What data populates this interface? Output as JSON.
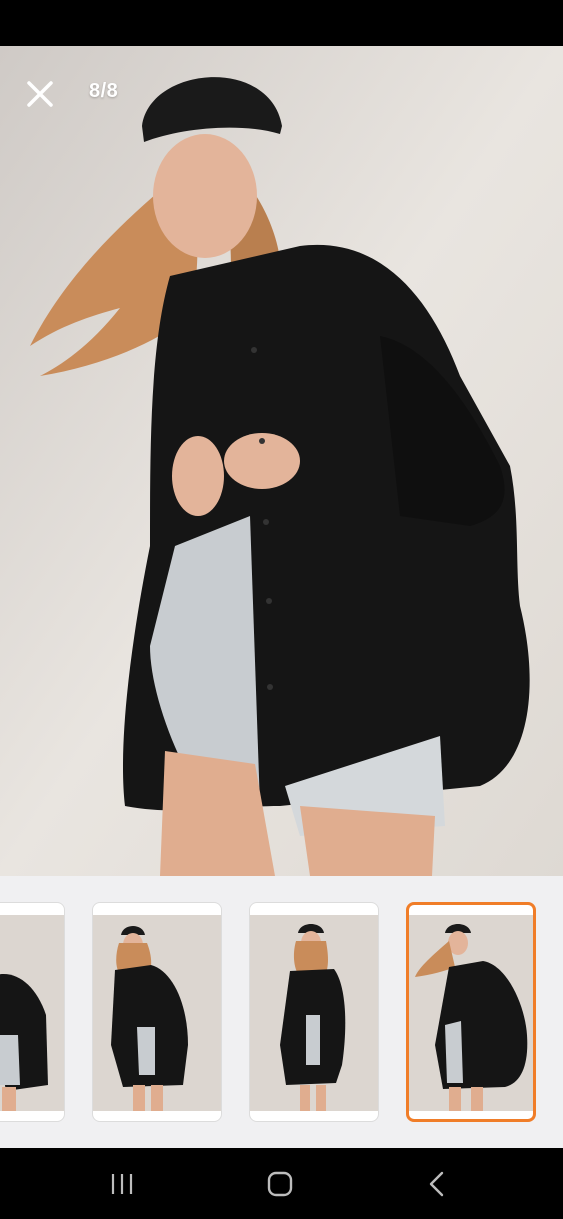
{
  "viewer": {
    "counter": "8/8",
    "close_icon": "close-icon"
  },
  "thumbnails": [
    {
      "index": 5,
      "selected": false
    },
    {
      "index": 6,
      "selected": false
    },
    {
      "index": 7,
      "selected": false
    },
    {
      "index": 8,
      "selected": true
    }
  ],
  "colors": {
    "accent": "#f07d28",
    "photo_background": "#e6e2dd",
    "shirt": "#151515",
    "hair": "#c98c5a",
    "denim": "#c8ccd0",
    "skin": "#e3b49a"
  },
  "nav": {
    "recent_icon": "recent-apps-icon",
    "home_icon": "home-icon",
    "back_icon": "back-icon"
  }
}
